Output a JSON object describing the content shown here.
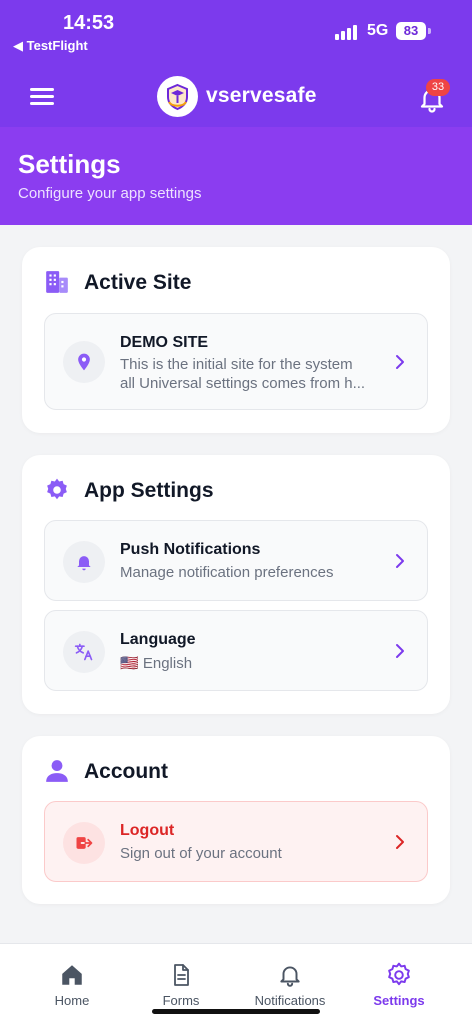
{
  "status_bar": {
    "time": "14:53",
    "back_label": "◀ TestFlight",
    "network": "5G",
    "battery": "83"
  },
  "header": {
    "brand": "vservesafe",
    "notification_count": "33"
  },
  "page": {
    "title": "Settings",
    "subtitle": "Configure your app settings"
  },
  "active_site": {
    "title": "Active Site",
    "item": {
      "title": "DEMO SITE",
      "desc_line1": "This is the initial site for the system",
      "desc_line2": "all Universal settings comes from h..."
    }
  },
  "app_settings": {
    "title": "App Settings",
    "items": [
      {
        "title": "Push Notifications",
        "desc": "Manage notification preferences"
      },
      {
        "title": "Language",
        "desc": "🇺🇸 English"
      }
    ]
  },
  "account": {
    "title": "Account",
    "item": {
      "title": "Logout",
      "desc": "Sign out of your account"
    }
  },
  "tabs": [
    {
      "label": "Home",
      "icon": "home-icon"
    },
    {
      "label": "Forms",
      "icon": "document-icon"
    },
    {
      "label": "Notifications",
      "icon": "bell-icon"
    },
    {
      "label": "Settings",
      "icon": "gear-icon",
      "active": true
    }
  ],
  "colors": {
    "primary": "#7c3aed",
    "danger": "#dc2626",
    "background": "#f3f4f6"
  }
}
